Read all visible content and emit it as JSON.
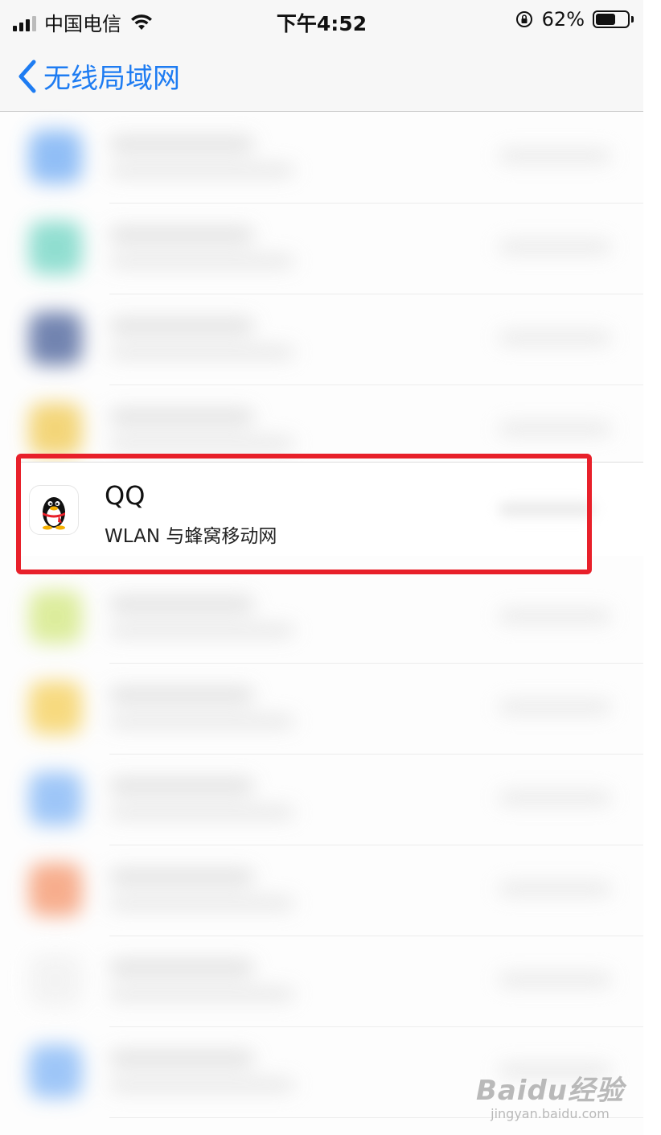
{
  "status_bar": {
    "carrier": "中国电信",
    "time": "下午4:52",
    "battery_text": "62%",
    "battery_level": 0.62,
    "icons": [
      "signal-icon",
      "wifi-icon",
      "rotation-lock-icon",
      "battery-icon"
    ]
  },
  "nav": {
    "back_label": "无线局域网",
    "back_icon": "chevron-left-icon"
  },
  "colors": {
    "accent": "#1e7cf2",
    "highlight": "#e8202a"
  },
  "blurred_app_colors_above": [
    "#7fb4f5",
    "#7ed9c9",
    "#5a6fa3",
    "#f2cf63"
  ],
  "highlighted_app": {
    "name": "QQ",
    "network_setting": "WLAN 与蜂窝移动网",
    "icon": "qq-penguin-icon"
  },
  "blurred_app_colors_below": [
    "#d7ea8c",
    "#f6d46a",
    "#8ebdf7",
    "#f6a07a",
    "#f2f2f2",
    "#8ebdf7"
  ],
  "watermark": {
    "main": "Baidu经验",
    "sub": "jingyan.baidu.com"
  }
}
